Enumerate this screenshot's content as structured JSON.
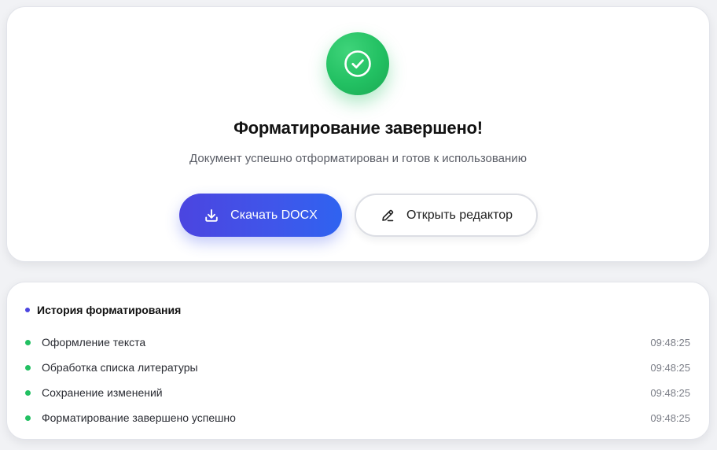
{
  "success": {
    "title": "Форматирование завершено!",
    "subtitle": "Документ успешно отформатирован и готов к использованию",
    "icon": "check-circle-icon",
    "color": "#22c062"
  },
  "actions": {
    "download_label": "Скачать DOCX",
    "download_icon": "download-icon",
    "editor_label": "Открыть редактор",
    "editor_icon": "pencil-icon",
    "accent": "#4b45e0"
  },
  "history": {
    "title": "История форматирования",
    "items": [
      {
        "label": "Оформление текста",
        "time": "09:48:25"
      },
      {
        "label": "Обработка списка литературы",
        "time": "09:48:25"
      },
      {
        "label": "Сохранение изменений",
        "time": "09:48:25"
      },
      {
        "label": "Форматирование завершено успешно",
        "time": "09:48:25"
      }
    ]
  }
}
